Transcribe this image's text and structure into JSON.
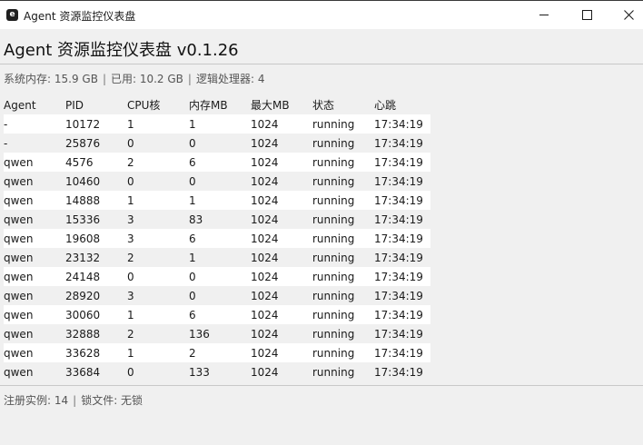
{
  "window": {
    "title": "Agent 资源监控仪表盘",
    "icon": "app-e-icon"
  },
  "header": {
    "title": "Agent 资源监控仪表盘 v0.1.26"
  },
  "system": {
    "mem_label": "系统内存: 15.9 GB",
    "used_label": "已用: 10.2 GB",
    "cpu_label": "逻辑处理器: 4",
    "separator": "|"
  },
  "table": {
    "columns": [
      "Agent",
      "PID",
      "CPU核",
      "内存MB",
      "最大MB",
      "状态",
      "心跳"
    ],
    "rows": [
      [
        "-",
        "10172",
        "1",
        "1",
        "1024",
        "running",
        "17:34:19"
      ],
      [
        "-",
        "25876",
        "0",
        "0",
        "1024",
        "running",
        "17:34:19"
      ],
      [
        "qwen",
        "4576",
        "2",
        "6",
        "1024",
        "running",
        "17:34:19"
      ],
      [
        "qwen",
        "10460",
        "0",
        "0",
        "1024",
        "running",
        "17:34:19"
      ],
      [
        "qwen",
        "14888",
        "1",
        "1",
        "1024",
        "running",
        "17:34:19"
      ],
      [
        "qwen",
        "15336",
        "3",
        "83",
        "1024",
        "running",
        "17:34:19"
      ],
      [
        "qwen",
        "19608",
        "3",
        "6",
        "1024",
        "running",
        "17:34:19"
      ],
      [
        "qwen",
        "23132",
        "2",
        "1",
        "1024",
        "running",
        "17:34:19"
      ],
      [
        "qwen",
        "24148",
        "0",
        "0",
        "1024",
        "running",
        "17:34:19"
      ],
      [
        "qwen",
        "28920",
        "3",
        "0",
        "1024",
        "running",
        "17:34:19"
      ],
      [
        "qwen",
        "30060",
        "1",
        "6",
        "1024",
        "running",
        "17:34:19"
      ],
      [
        "qwen",
        "32888",
        "2",
        "136",
        "1024",
        "running",
        "17:34:19"
      ],
      [
        "qwen",
        "33628",
        "1",
        "2",
        "1024",
        "running",
        "17:34:19"
      ],
      [
        "qwen",
        "33684",
        "0",
        "133",
        "1024",
        "running",
        "17:34:19"
      ]
    ]
  },
  "footer": {
    "instances_label": "注册实例: 14",
    "lock_label": "锁文件: 无锁",
    "separator": "|"
  },
  "colors": {
    "background": "#f0f0f0",
    "row_alt": "#ffffff",
    "text": "#1a1a1a",
    "muted": "#555555"
  }
}
